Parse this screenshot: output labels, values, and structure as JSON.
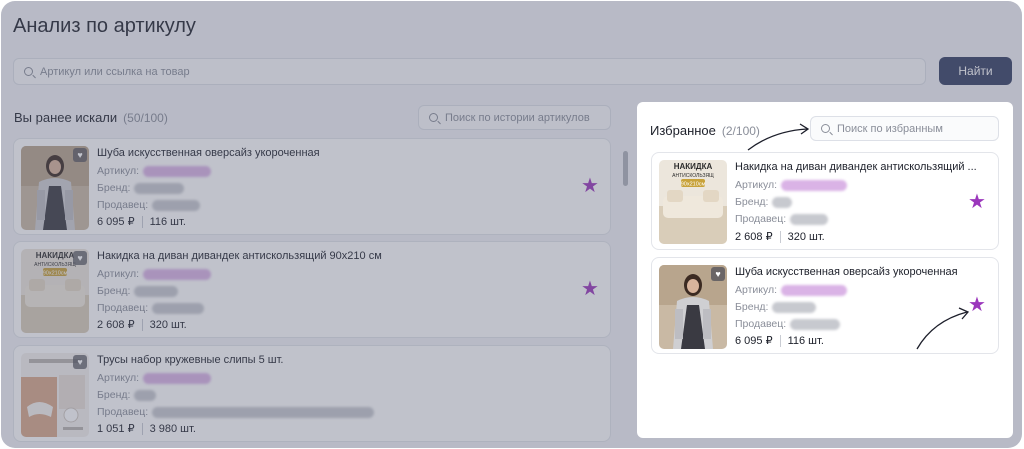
{
  "page": {
    "title": "Анализ по артикулу",
    "search_placeholder": "Артикул или ссылка на товар",
    "find_label": "Найти"
  },
  "history": {
    "title": "Вы ранее искали",
    "count": "(50/100)",
    "search_placeholder": "Поиск по истории артикулов",
    "items": [
      {
        "title": "Шуба искусственная оверсайз укороченная",
        "article_label": "Артикул:",
        "brand_label": "Бренд:",
        "seller_label": "Продавец:",
        "price": "6 095 ₽",
        "quantity": "116 шт.",
        "favorite": true
      },
      {
        "title": "Накидка на диван дивандек антискользящий 90х210 см",
        "article_label": "Артикул:",
        "brand_label": "Бренд:",
        "seller_label": "Продавец:",
        "price": "2 608 ₽",
        "quantity": "320 шт.",
        "favorite": true
      },
      {
        "title": "Трусы набор кружевные слипы 5 шт.",
        "article_label": "Артикул:",
        "brand_label": "Бренд:",
        "seller_label": "Продавец:",
        "price": "1 051 ₽",
        "quantity": "3 980 шт.",
        "favorite": false
      }
    ]
  },
  "favorites": {
    "title": "Избранное",
    "count": "(2/100)",
    "search_placeholder": "Поиск по избранным",
    "items": [
      {
        "title": "Накидка на диван дивандек антискользящий ...",
        "article_label": "Артикул:",
        "brand_label": "Бренд:",
        "seller_label": "Продавец:",
        "price": "2 608 ₽",
        "quantity": "320 шт.",
        "favorite": true
      },
      {
        "title": "Шуба искусственная оверсайз укороченная",
        "article_label": "Артикул:",
        "brand_label": "Бренд:",
        "seller_label": "Продавец:",
        "price": "6 095 ₽",
        "quantity": "116 шт.",
        "favorite": true
      }
    ]
  },
  "thumb_texts": {
    "blanket_line1": "НАКИДКА",
    "blanket_line2": "АНТИСКОЛЬЗЯЩ",
    "blanket_size": "90х210см"
  },
  "icons": {
    "search": "search-icon",
    "heart": "heart-icon",
    "star": "star-icon"
  },
  "colors": {
    "accent_button": "#353f63",
    "favorite_star": "#9b37bc",
    "overlay": "#5a5e76"
  }
}
